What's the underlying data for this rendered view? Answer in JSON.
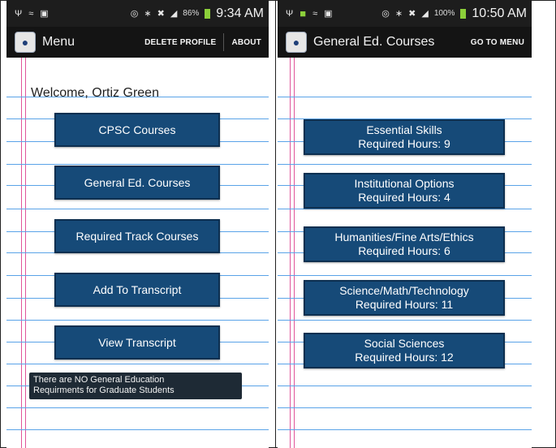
{
  "left": {
    "status": {
      "time": "9:34 AM",
      "battery": "86%"
    },
    "actionbar": {
      "title": "Menu",
      "delete_profile": "DELETE PROFILE",
      "about": "ABOUT"
    },
    "welcome": "Welcome, Ortiz Green",
    "buttons": [
      "CPSC Courses",
      "General Ed. Courses",
      "Required Track Courses",
      "Add To Transcript",
      "View Transcript"
    ],
    "toast": {
      "line1": "There are NO General Education",
      "line2": "Requirments for Graduate Students"
    }
  },
  "right": {
    "status": {
      "time": "10:50 AM",
      "battery": "100%"
    },
    "actionbar": {
      "title": "General Ed. Courses",
      "go_to_menu": "GO TO MENU"
    },
    "categories": [
      {
        "name": "Essential Skills",
        "hours": "Required Hours: 9"
      },
      {
        "name": "Institutional Options",
        "hours": "Required Hours: 4"
      },
      {
        "name": "Humanities/Fine Arts/Ethics",
        "hours": "Required Hours: 6"
      },
      {
        "name": "Science/Math/Technology",
        "hours": "Required Hours: 11"
      },
      {
        "name": "Social Sciences",
        "hours": "Required Hours: 12"
      }
    ]
  },
  "colors": {
    "button_bg": "#164a78",
    "rule_blue": "#5aa3e8",
    "margin_pink": "#e0559a",
    "bar_bg": "#1d1d1d"
  }
}
